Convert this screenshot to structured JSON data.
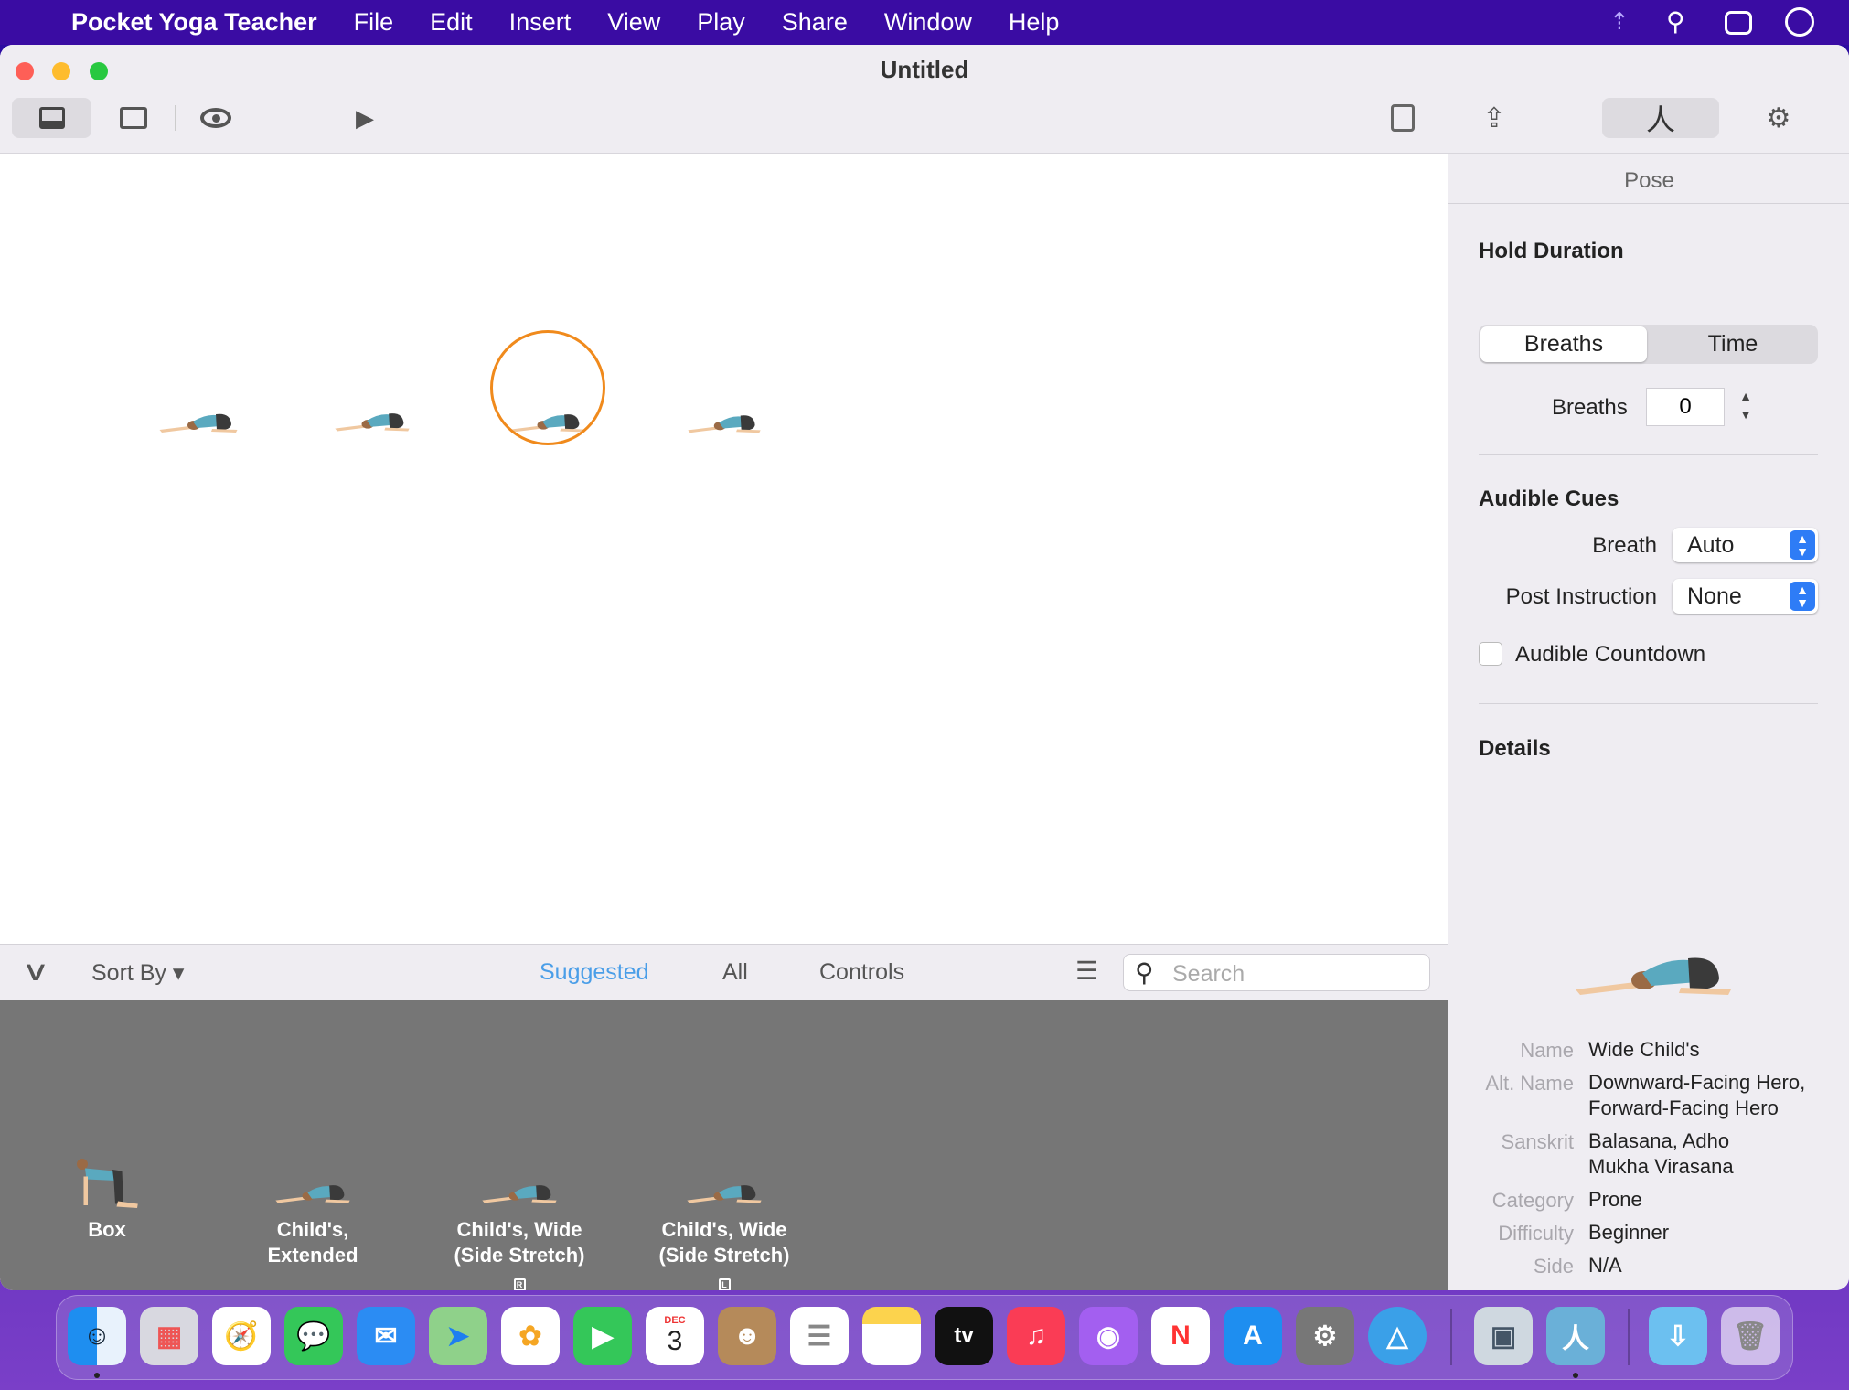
{
  "menubar": {
    "app": "Pocket Yoga Teacher",
    "items": [
      "File",
      "Edit",
      "Insert",
      "View",
      "Play",
      "Share",
      "Window",
      "Help"
    ]
  },
  "window": {
    "title": "Untitled"
  },
  "toolbar": {
    "icons": [
      "bottom-panel-icon",
      "single-panel-icon",
      "eye-icon",
      "play-icon",
      "print-icon",
      "share-icon",
      "pose-icon",
      "gear-icon"
    ]
  },
  "canvas": {
    "poses": [
      "Child's, Extended",
      "Child's, Wide",
      "Wide Child's",
      "Child's, Wide"
    ],
    "selected_index": 2,
    "accent": "#f08a1c"
  },
  "inspector": {
    "header": "Pose",
    "hold_duration": {
      "title": "Hold Duration",
      "segments": [
        "Breaths",
        "Time"
      ],
      "selected": "Breaths",
      "breaths_label": "Breaths",
      "breaths_value": "0"
    },
    "audible_cues": {
      "title": "Audible Cues",
      "breath_label": "Breath",
      "breath_value": "Auto",
      "post_label": "Post Instruction",
      "post_value": "None",
      "countdown_label": "Audible Countdown",
      "countdown_checked": false
    },
    "details": {
      "title": "Details",
      "rows": [
        {
          "label": "Name",
          "value": "Wide Child's"
        },
        {
          "label": "Alt. Name",
          "value": "Downward-Facing Hero, Forward-Facing Hero"
        },
        {
          "label": "Sanskrit",
          "value": "Balasana, Adho Mukha Virasana"
        },
        {
          "label": "Category",
          "value": "Prone"
        },
        {
          "label": "Difficulty",
          "value": "Beginner"
        },
        {
          "label": "Side",
          "value": "N/A"
        }
      ]
    }
  },
  "library_bar": {
    "sort_by": "Sort By ▾",
    "tabs": [
      "Suggested",
      "All",
      "Controls"
    ],
    "active_tab": "Suggested",
    "search_placeholder": "Search",
    "accent": "#4a9ee8"
  },
  "library": {
    "items": [
      {
        "name": "Box",
        "badge": ""
      },
      {
        "name": "Child's, Extended",
        "badge": ""
      },
      {
        "name": "Child's, Wide (Side Stretch)",
        "badge": "R"
      },
      {
        "name": "Child's, Wide (Side Stretch)",
        "badge": "L"
      }
    ]
  },
  "dock": {
    "apps": [
      "Finder",
      "Launchpad",
      "Safari",
      "Messages",
      "Mail",
      "Maps",
      "Photos",
      "FaceTime",
      "Calendar",
      "Contacts",
      "Reminders",
      "Notes",
      "TV",
      "Music",
      "Podcasts",
      "News",
      "App Store",
      "System Preferences",
      "Pocket Yoga Teacher Alt",
      "Preview",
      "Pocket Yoga Teacher",
      "Downloads",
      "Trash"
    ],
    "calendar_month": "DEC",
    "calendar_day": "3",
    "tv_label": "tv"
  }
}
